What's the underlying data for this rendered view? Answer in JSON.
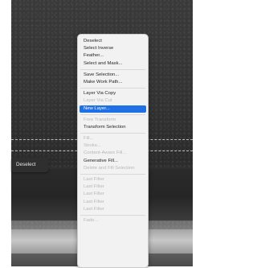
{
  "canvas": {
    "contextual_bar": {
      "button_label": "Deselect"
    }
  },
  "context_menu": {
    "groups": [
      [
        {
          "label": "Deselect",
          "enabled": true
        },
        {
          "label": "Select Inverse",
          "enabled": true
        },
        {
          "label": "Feather...",
          "enabled": true
        },
        {
          "label": "Select and Mask...",
          "enabled": true
        }
      ],
      [
        {
          "label": "Save Selection...",
          "enabled": true
        },
        {
          "label": "Make Work Path...",
          "enabled": true
        }
      ],
      [
        {
          "label": "Layer Via Copy",
          "enabled": true
        },
        {
          "label": "Layer Via Cut",
          "enabled": false
        },
        {
          "label": "New Layer...",
          "enabled": true,
          "highlighted": true
        }
      ],
      [
        {
          "label": "Free Transform",
          "enabled": false
        },
        {
          "label": "Transform Selection",
          "enabled": true
        }
      ],
      [
        {
          "label": "Fill...",
          "enabled": false
        },
        {
          "label": "Stroke...",
          "enabled": false
        },
        {
          "label": "Content-Aware Fill...",
          "enabled": false
        },
        {
          "label": "Generative Fill...",
          "enabled": true
        },
        {
          "label": "Delete and Fill Selection",
          "enabled": false
        }
      ],
      [
        {
          "label": "Last Filter",
          "enabled": false
        },
        {
          "label": "Last Filter",
          "enabled": false
        },
        {
          "label": "Last Filter",
          "enabled": false
        },
        {
          "label": "Last Filter",
          "enabled": false
        },
        {
          "label": "Last Filter",
          "enabled": false
        }
      ],
      [
        {
          "label": "Fade...",
          "enabled": false
        }
      ]
    ],
    "highlight_color": "#1f6fe5"
  }
}
